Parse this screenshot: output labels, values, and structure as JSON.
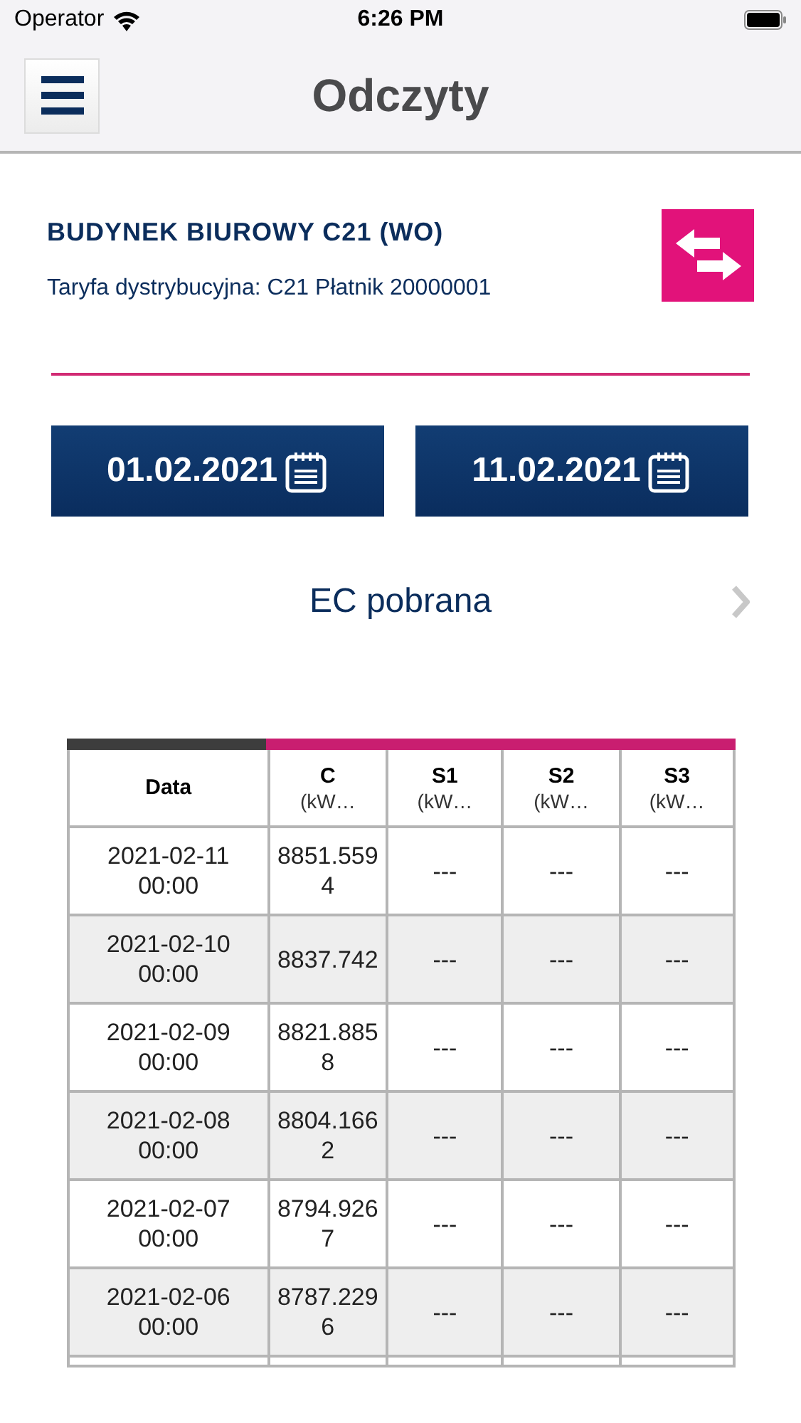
{
  "status_bar": {
    "carrier": "Operator",
    "time": "6:26 PM"
  },
  "nav": {
    "title": "Odczyty"
  },
  "building": {
    "name": "BUDYNEK BIUROWY C21 (WO)",
    "tariff": "Taryfa dystrybucyjna: C21 Płatnik 20000001"
  },
  "date_buttons": [
    {
      "label": "01.02.2021"
    },
    {
      "label": "11.02.2021"
    }
  ],
  "selector": {
    "label": "EC pobrana"
  },
  "table": {
    "columns": [
      {
        "name": "Data"
      },
      {
        "name": "C",
        "unit": "(kW…"
      },
      {
        "name": "S1",
        "unit": "(kW…"
      },
      {
        "name": "S2",
        "unit": "(kW…"
      },
      {
        "name": "S3",
        "unit": "(kW…"
      }
    ],
    "rows": [
      [
        "2021-02-11 00:00",
        "8851.5594",
        "---",
        "---",
        "---"
      ],
      [
        "2021-02-10 00:00",
        "8837.742",
        "---",
        "---",
        "---"
      ],
      [
        "2021-02-09 00:00",
        "8821.8858",
        "---",
        "---",
        "---"
      ],
      [
        "2021-02-08 00:00",
        "8804.1662",
        "---",
        "---",
        "---"
      ],
      [
        "2021-02-07 00:00",
        "8794.9267",
        "---",
        "---",
        "---"
      ],
      [
        "2021-02-06 00:00",
        "8787.2296",
        "---",
        "---",
        "---"
      ]
    ]
  }
}
